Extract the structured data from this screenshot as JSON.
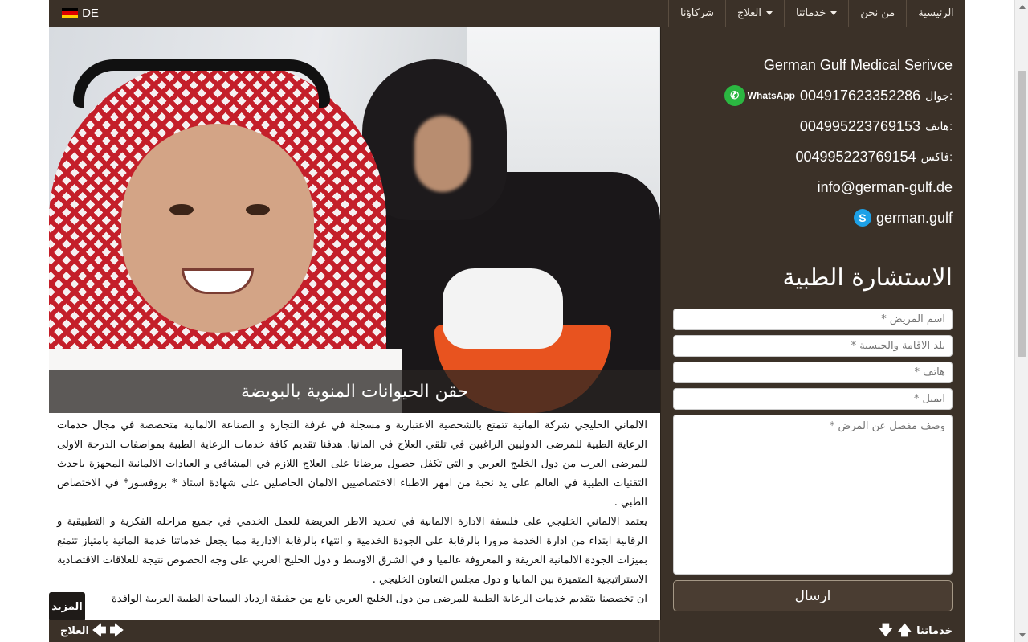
{
  "nav": {
    "language": "DE",
    "items": [
      "الرئيسية",
      "من نحن",
      "خدماتنا",
      "العلاج",
      "شركاؤنا"
    ]
  },
  "hero": {
    "caption": "حقن الحيوانات المنوية بالبويضة"
  },
  "article": {
    "paragraphs": [
      "الالماني الخليجي شركة المانية تتمتع بالشخصية الاعتبارية و مسجلة في غرفة التجارة و الصناعة الالمانية متخصصة في مجال خدمات الرعاية الطبية للمرضى الدوليين الراغبين في تلقي العلاج في المانيا. هدفنا تقديم كافة خدمات الرعاية الطبية بمواصفات الدرجة الاولى للمرضى العرب من دول الخليج العربي و التي تكفل حصول مرضانا على العلاج اللازم في المشافي و العيادات الالمانية المجهزة باحدث التقنيات الطبية في العالم على يد نخبة من امهر الاطباء الاختصاصيين الالمان الحاصلين على شهادة استاذ * بروفسور* في الاختصاص الطبي .",
      "يعتمد الالماني الخليجي على فلسفة الادارة الالمانية في تحديد الاطر العريضة للعمل الخدمي في جميع مراحله الفكرية و التطبيقية و الرقابية ابتداء من ادارة الخدمة مرورا بالرقابة على الجودة الخدمية و انتهاء بالرقابة الادارية مما يجعل خدماتنا خدمة المانية بامتياز تتمتع بميزات الجودة الالمانية العريقة و المعروفة عالميا و في الشرق الاوسط و دول الخليج العربي على وجه الخصوص نتيجة للعلاقات الاقتصادية الاستراتيجية المتميزة بين المانيا و دول مجلس التعاون الخليجي .",
      "ان تخصصنا بتقديم خدمات الرعاية الطبية للمرضى من دول الخليج العربي نابع من حقيقة ازدياد السياحة الطبية العربية الوافدة"
    ],
    "more_label": "المزيد"
  },
  "contact": {
    "company": "German Gulf Medical Serivce",
    "mobile_label": "جوال:",
    "mobile": "004917623352286",
    "whatsapp_label": "WhatsApp",
    "phone_label": "هاتف:",
    "phone": "004995223769153",
    "fax_label": "فاكس:",
    "fax": "004995223769154",
    "email": "info@german-gulf.de",
    "skype": "german.gulf"
  },
  "form": {
    "title": "الاستشارة الطبية",
    "patient_name_placeholder": "اسم المريض *",
    "country_placeholder": "بلد الاقامة والجنسية *",
    "phone_placeholder": "هاتف *",
    "email_placeholder": "ايميل *",
    "description_placeholder": "وصف مفصل عن المرض *",
    "submit_label": "ارسال"
  },
  "footer": {
    "left_label": "العلاج",
    "right_label": "خدماتنا"
  },
  "colors": {
    "brand_dark": "#3b3128",
    "whatsapp": "#2bb741",
    "skype": "#1da1e8"
  }
}
